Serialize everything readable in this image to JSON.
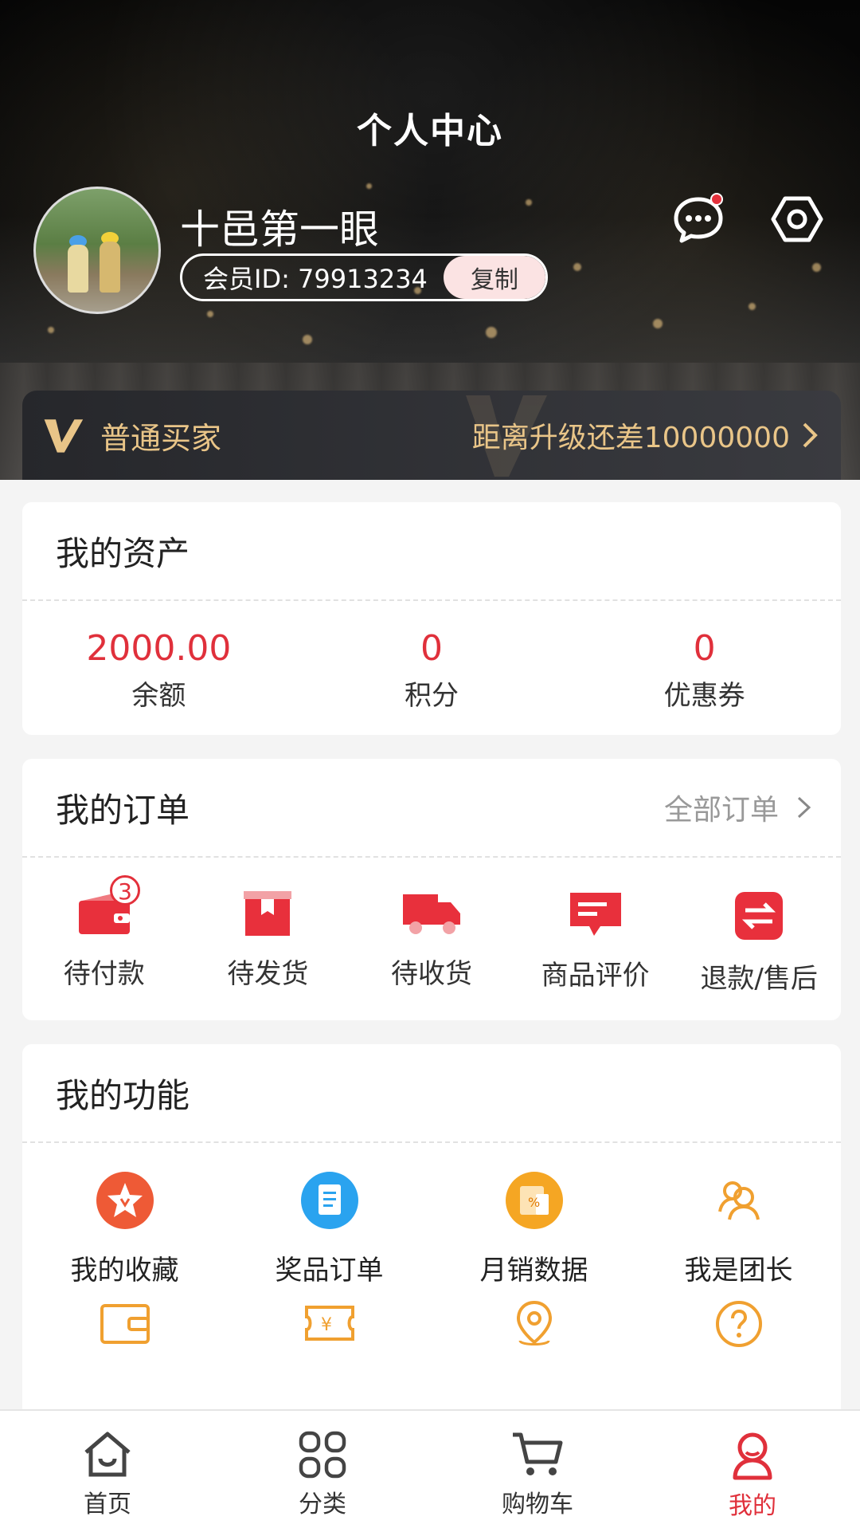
{
  "header": {
    "title": "个人中心",
    "username": "十邑第一眼",
    "member_id": "会员ID: 79913234",
    "copy_label": "复制",
    "message_icon": "chat-bubble-icon",
    "settings_icon": "hexagon-gear-icon"
  },
  "vip": {
    "level": "普通买家",
    "upgrade_text": "距离升级还差10000000",
    "accent": "#e9c588"
  },
  "assets": {
    "title": "我的资产",
    "items": [
      {
        "value": "2000.00",
        "label": "余额",
        "color": "#e0303b"
      },
      {
        "value": "0",
        "label": "积分",
        "color": "#e0303b"
      },
      {
        "value": "0",
        "label": "优惠券",
        "color": "#e0303b"
      }
    ]
  },
  "orders": {
    "title": "我的订单",
    "all_label": "全部订单",
    "items": [
      {
        "label": "待付款",
        "icon": "wallet-icon",
        "badge": "3"
      },
      {
        "label": "待发货",
        "icon": "box-icon"
      },
      {
        "label": "待收货",
        "icon": "truck-icon"
      },
      {
        "label": "商品评价",
        "icon": "comment-icon"
      },
      {
        "label": "退款/售后",
        "icon": "refund-icon"
      }
    ]
  },
  "functions": {
    "title": "我的功能",
    "items": [
      {
        "label": "我的收藏",
        "icon": "favorite-star-icon"
      },
      {
        "label": "奖品订单",
        "icon": "prize-order-icon"
      },
      {
        "label": "月销数据",
        "icon": "sales-data-icon"
      },
      {
        "label": "我是团长",
        "icon": "team-leader-icon"
      },
      {
        "label": "",
        "icon": "wallet-icon"
      },
      {
        "label": "",
        "icon": "yen-ticket-icon"
      },
      {
        "label": "",
        "icon": "location-icon"
      },
      {
        "label": "",
        "icon": "help-icon"
      }
    ]
  },
  "tabbar": {
    "active_color": "#e0303b",
    "items": [
      {
        "label": "首页",
        "icon": "home-icon"
      },
      {
        "label": "分类",
        "icon": "grid-icon"
      },
      {
        "label": "购物车",
        "icon": "cart-icon"
      },
      {
        "label": "我的",
        "icon": "profile-icon",
        "active": true
      }
    ]
  }
}
